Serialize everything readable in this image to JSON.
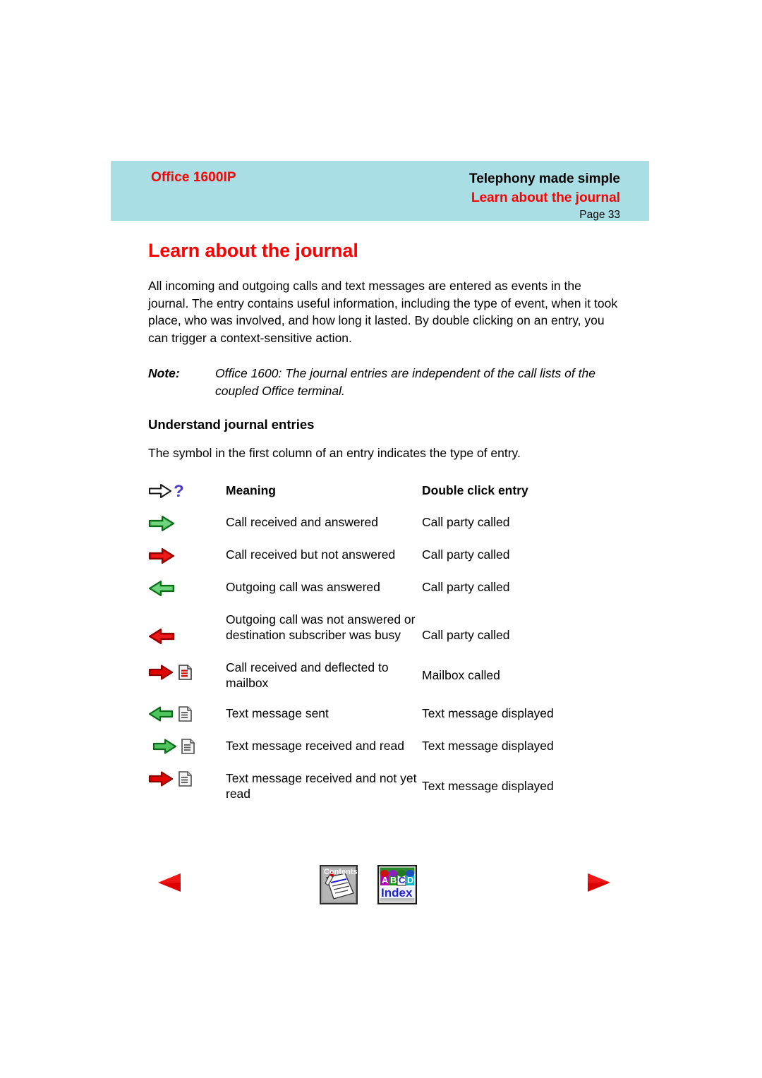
{
  "header": {
    "product": "Office 1600IP",
    "tagline": "Telephony made simple",
    "section": "Learn about the journal",
    "page_label": "Page 33",
    "band_color": "#aadee5",
    "accent_color": "#ff0000"
  },
  "page": {
    "title": "Learn about the journal",
    "intro": "All incoming and outgoing calls and text messages are entered as events in the journal. The entry contains useful information, including the type of event, when it took place, who was involved, and how long it lasted. By double clicking on an entry, you can trigger a context-sensitive action.",
    "note_label": "Note:",
    "note_text": "Office 1600: The journal entries are independent of the call lists of the coupled Office terminal.",
    "subheading": "Understand journal entries",
    "lead": "The symbol in the first column of an entry indicates the type of entry."
  },
  "table": {
    "headers": {
      "symbol_icon": "arrow-question-icon",
      "meaning": "Meaning",
      "double_click": "Double click entry"
    },
    "rows": [
      {
        "icon": "green-right-arrow-icon",
        "meaning": "Call received and answered",
        "double_click": "Call party called"
      },
      {
        "icon": "red-right-arrow-icon",
        "meaning": "Call received but not answered",
        "double_click": "Call party called"
      },
      {
        "icon": "green-left-arrow-icon",
        "meaning": "Outgoing call was answered",
        "double_click": "Call party called"
      },
      {
        "icon": "red-left-arrow-icon",
        "meaning": "Outgoing call was not answered or destination subscriber was busy",
        "double_click": "Call party called"
      },
      {
        "icon": "red-right-arrow-mailbox-icon",
        "meaning": "Call received and deflected to mailbox",
        "double_click": "Mailbox called"
      },
      {
        "icon": "green-left-arrow-document-icon",
        "meaning": "Text message sent",
        "double_click": "Text message displayed"
      },
      {
        "icon": "green-right-arrow-document-icon",
        "meaning": "Text message received and read",
        "double_click": "Text message displayed"
      },
      {
        "icon": "red-right-arrow-document-icon",
        "meaning": "Text message received and not yet read",
        "double_click": "Text message displayed"
      }
    ]
  },
  "footer": {
    "prev_icon": "previous-page-triangle-icon",
    "next_icon": "next-page-triangle-icon",
    "contents_label": "Contents",
    "index_label": "Index",
    "index_letters": [
      "A",
      "B",
      "C",
      "D"
    ]
  },
  "colors": {
    "green_fill": "#44c254",
    "green_stroke": "#0a6b18",
    "green_light": "#7fd98c",
    "red_fill": "#e00000",
    "red_stroke": "#8d0000",
    "question_mark": "#4b3ccc",
    "nav_red": "#dd0000"
  }
}
